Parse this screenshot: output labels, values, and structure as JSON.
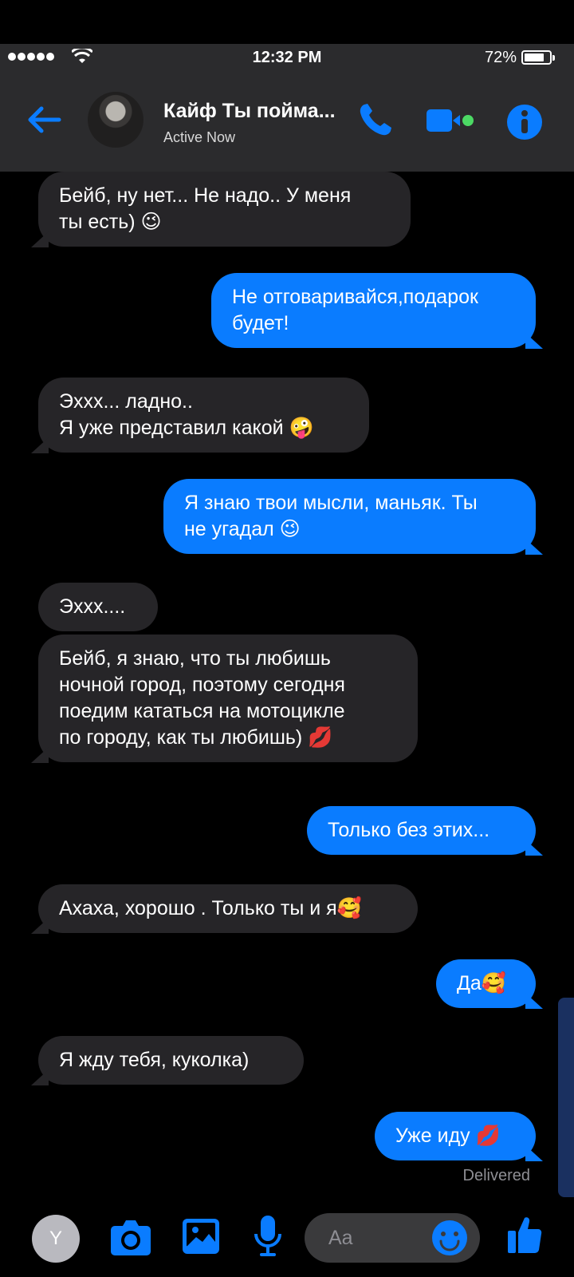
{
  "status_bar": {
    "time": "12:32 PM",
    "battery": "72%"
  },
  "header": {
    "name": "Кайф Ты пойма...",
    "status": "Active Now"
  },
  "messages": [
    {
      "side": "in",
      "text": "Бейб, ну нет... Не надо.. У меня\nты есть) 😉"
    },
    {
      "side": "out",
      "text": "Не отговаривайся,подарок\nбудет!"
    },
    {
      "side": "in",
      "text": "Эххх... ладно..\nЯ уже представил какой 🤪"
    },
    {
      "side": "out",
      "text": "Я знаю твои мысли, маньяк. Ты\nне угадал 😉"
    },
    {
      "side": "in",
      "text": "Эххх...."
    },
    {
      "side": "in",
      "text": "Бейб, я знаю, что ты любишь\nночной город, поэтому сегодня\nпоедим кататься на мотоцикле\nпо городу, как ты любишь) 💋"
    },
    {
      "side": "out",
      "text": "Только без этих..."
    },
    {
      "side": "in",
      "text": "Ахаха, хорошо  . Только ты и я🥰"
    },
    {
      "side": "out",
      "text": "Да🥰"
    },
    {
      "side": "in",
      "text": "Я жду тебя, куколка)"
    },
    {
      "side": "out",
      "text": "Уже иду 💋"
    }
  ],
  "delivered": "Delivered",
  "composer": {
    "avatar_letter": "Y",
    "placeholder": "Aa"
  },
  "colors": {
    "accent": "#0a7cff",
    "incoming_bubble": "#262528",
    "header_bg": "#2b2b2d"
  }
}
